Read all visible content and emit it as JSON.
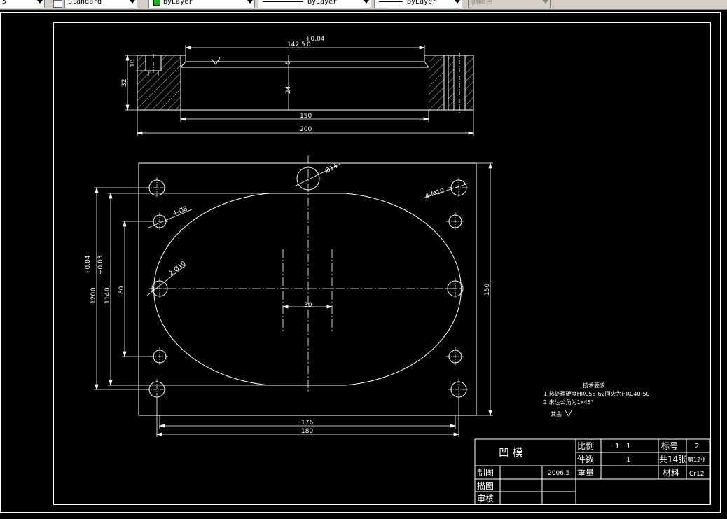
{
  "toolbar": {
    "first_combo": "5",
    "text_style": "Standard",
    "layer": "ByLayer",
    "linetype": "ByLayer",
    "lineweight": "ByLayer",
    "plot_style": "随颜色"
  },
  "colors": {
    "background": "#000000",
    "drawing": "#ffffff",
    "layer_swatch": "#00c000"
  },
  "drawing": {
    "section_dims": {
      "top_width": "142.5",
      "top_tol_upper": "+0.04",
      "top_tol_lower": "0",
      "depth_5": "5",
      "depth_24": "24",
      "left_10": "10",
      "left_32": "32",
      "bottom_150": "150",
      "bottom_200": "200"
    },
    "plan_dims": {
      "d14": "Ø14",
      "m10": "4-M10",
      "d8": "4-Ø8",
      "d10": "2-Ø10",
      "w30": "30",
      "h80": "80",
      "h150": "150",
      "w176": "176",
      "w180": "180",
      "h114": "114",
      "h114_tol_upper": "+0.03",
      "h114_tol_lower": "0",
      "h120": "120",
      "h120_tol_upper": "+0.04",
      "h120_tol_lower": "0"
    },
    "notes": {
      "title": "技术要求",
      "line1": "1  热处理硬度HRC58-62回火为HRC40-50",
      "line2": "2  未注公角为1x45°",
      "rest": "其余"
    },
    "title_block": {
      "part_name": "凹    模",
      "scale_label": "比例",
      "scale_value": "1  :  1",
      "drawing_no_label": "标号",
      "drawing_no": "2",
      "qty_label": "件数",
      "qty_value": "1",
      "sheets_total": "共14张",
      "sheet_no": "第12张",
      "weight_label": "重量",
      "material_label": "材料",
      "material_value": "Cr12",
      "drawn_label": "制图",
      "date": "2006.5",
      "traced_label": "描图",
      "checked_label": "审核"
    }
  }
}
